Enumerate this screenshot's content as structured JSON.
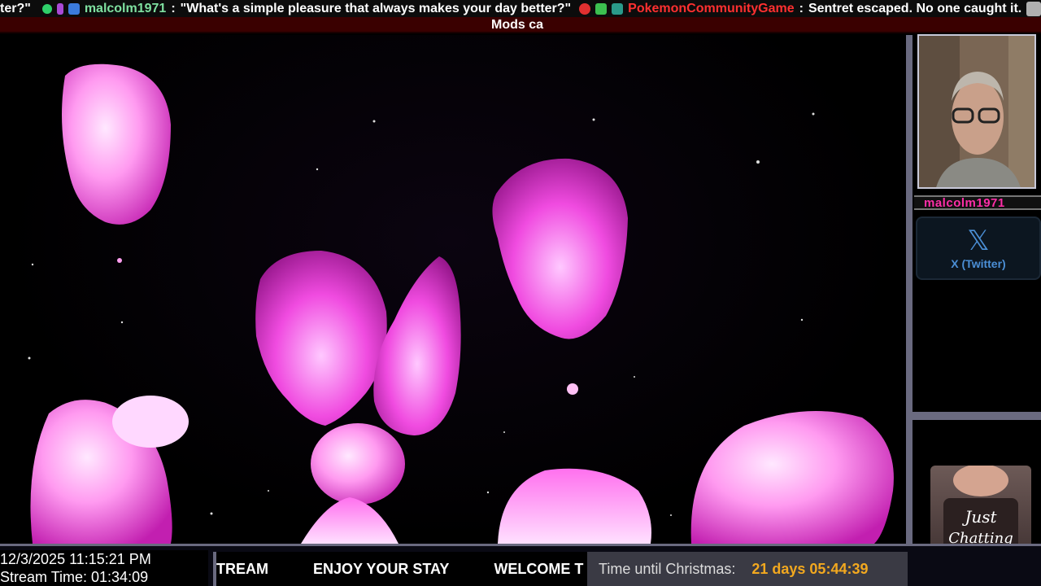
{
  "ticker": {
    "prev_fragment": "ter?\"",
    "user": "malcolm1971",
    "message": "\"What's a simple pleasure that always makes your day better?\"",
    "bot_user": "PokemonCommunityGame",
    "bot_message": "Sentret escaped. No one caught it.",
    "colon": ":"
  },
  "mods_text": "Mods ca",
  "streamer_name": "malcolm1971",
  "social": {
    "label": "X (Twitter)",
    "icon": "x-logo-icon"
  },
  "just_chatting": "Just Chatting",
  "clock": {
    "datetime": "12/3/2025 11:15:21 PM",
    "stream_time": "Stream Time: 01:34:09"
  },
  "marquee": [
    "TREAM",
    "ENJOY YOUR STAY",
    "WELCOME T"
  ],
  "countdown": {
    "label": "Time until Christmas:",
    "value": "21 days 05:44:39"
  },
  "colors": {
    "user_color": "#7fe0a0",
    "bot_color": "#ff3030",
    "accent_orange": "#f2a81f",
    "lava_pink": "#ff4fe0",
    "border": "#6a6a80"
  }
}
